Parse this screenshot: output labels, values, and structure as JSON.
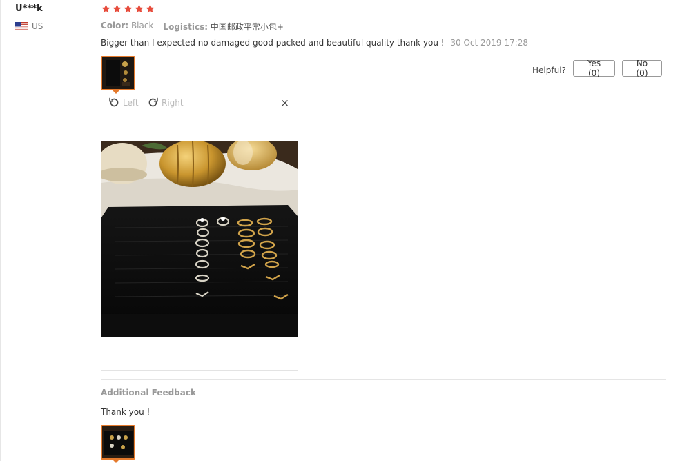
{
  "reviewer": {
    "name": "U***k",
    "country": "US",
    "flag_icon": "us-flag-icon"
  },
  "rating": {
    "stars": 5,
    "max": 5,
    "color": "#e74c3c"
  },
  "attributes": {
    "color_label": "Color:",
    "color_value": "Black",
    "logistics_label": "Logistics:",
    "logistics_value": "中国邮政平常小包+"
  },
  "review": {
    "text": "Bigger than I expected no damaged good packed and beautiful quality thank you !",
    "date": "30 Oct 2019 17:28"
  },
  "helpful": {
    "label": "Helpful?",
    "yes_label": "Yes (0)",
    "no_label": "No (0)"
  },
  "viewer": {
    "rotate_left_label": "Left",
    "rotate_right_label": "Right",
    "close_label": "×",
    "photo_description_icon": "jewelry-ring-tray-photo"
  },
  "additional": {
    "title": "Additional Feedback",
    "text": "Thank you !"
  },
  "colors": {
    "accent": "#e57a2c",
    "muted": "#999999",
    "border": "#e3e3e3"
  }
}
